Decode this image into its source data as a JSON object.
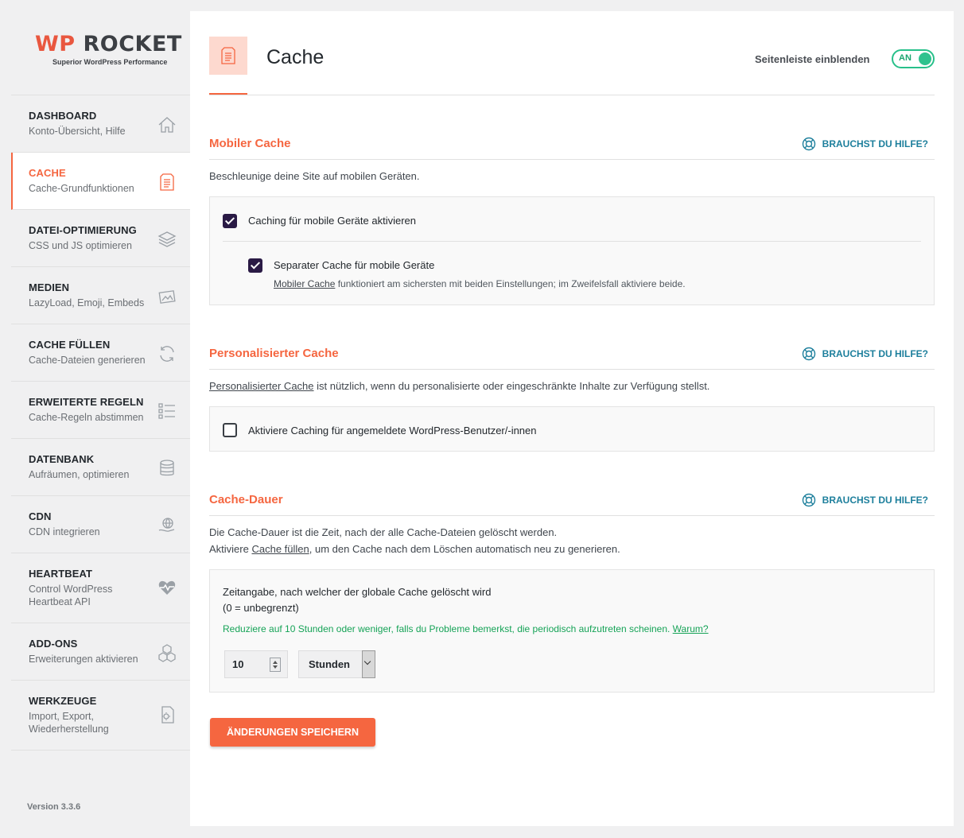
{
  "logo": {
    "brand_wp": "WP",
    "brand_rest": "ROCKET",
    "tagline": "Superior WordPress Performance"
  },
  "nav": [
    {
      "title": "DASHBOARD",
      "sub": "Konto-Übersicht, Hilfe",
      "icon": "home-icon"
    },
    {
      "title": "CACHE",
      "sub": "Cache-Grundfunktionen",
      "icon": "document-icon",
      "active": true
    },
    {
      "title": "DATEI-OPTIMIERUNG",
      "sub": "CSS und JS optimieren",
      "icon": "layers-icon"
    },
    {
      "title": "MEDIEN",
      "sub": "LazyLoad, Emoji, Embeds",
      "icon": "images-icon"
    },
    {
      "title": "CACHE FÜLLEN",
      "sub": "Cache-Dateien generieren",
      "icon": "refresh-icon"
    },
    {
      "title": "ERWEITERTE REGELN",
      "sub": "Cache-Regeln abstimmen",
      "icon": "checklist-icon"
    },
    {
      "title": "DATENBANK",
      "sub": "Aufräumen, optimieren",
      "icon": "database-icon"
    },
    {
      "title": "CDN",
      "sub": "CDN integrieren",
      "icon": "globe-hand-icon"
    },
    {
      "title": "HEARTBEAT",
      "sub": "Control WordPress Heartbeat API",
      "icon": "heart-pulse-icon"
    },
    {
      "title": "ADD-ONS",
      "sub": "Erweiterungen aktivieren",
      "icon": "cubes-icon"
    },
    {
      "title": "WERKZEUGE",
      "sub": "Import, Export, Wiederherstellung",
      "icon": "file-gear-icon"
    }
  ],
  "version": "Version 3.3.6",
  "header": {
    "title": "Cache",
    "sidebar_toggle_label": "Seitenleiste einblenden",
    "toggle_text": "AN"
  },
  "help_label": "BRAUCHST DU HILFE?",
  "mobile": {
    "title": "Mobiler Cache",
    "desc": "Beschleunige deine Site auf mobilen Geräten.",
    "opt1": "Caching für mobile Geräte aktivieren",
    "opt2": "Separater Cache für mobile Geräte",
    "note_link": "Mobiler Cache",
    "note_rest": " funktioniert am sichersten mit beiden Einstellungen; im Zweifelsfall aktiviere beide."
  },
  "personal": {
    "title": "Personalisierter Cache",
    "desc_link": "Personalisierter Cache",
    "desc_rest": " ist nützlich, wenn du personalisierte oder eingeschränkte Inhalte zur Verfügung stellst.",
    "opt": "Aktiviere Caching für angemeldete WordPress-Benutzer/-innen"
  },
  "lifespan": {
    "title": "Cache-Dauer",
    "desc1": "Die Cache-Dauer ist die Zeit, nach der alle Cache-Dateien gelöscht werden.",
    "desc2_pre": "Aktiviere ",
    "desc2_link": "Cache füllen",
    "desc2_post": ", um den Cache nach dem Löschen automatisch neu zu generieren.",
    "label1": "Zeitangabe, nach welcher der globale Cache gelöscht wird",
    "label2": "(0 = unbegrenzt)",
    "note": "Reduziere auf 10 Stunden oder weniger, falls du Probleme bemerkst, die periodisch aufzutreten scheinen. ",
    "note_link": "Warum?",
    "value": "10",
    "unit": "Stunden"
  },
  "save_label": "ÄNDERUNGEN SPEICHERN",
  "colors": {
    "accent": "#f56640",
    "checkbox": "#2a1a45",
    "toggle": "#2fc28e",
    "help": "#1d7f9c",
    "note": "#16a357"
  }
}
